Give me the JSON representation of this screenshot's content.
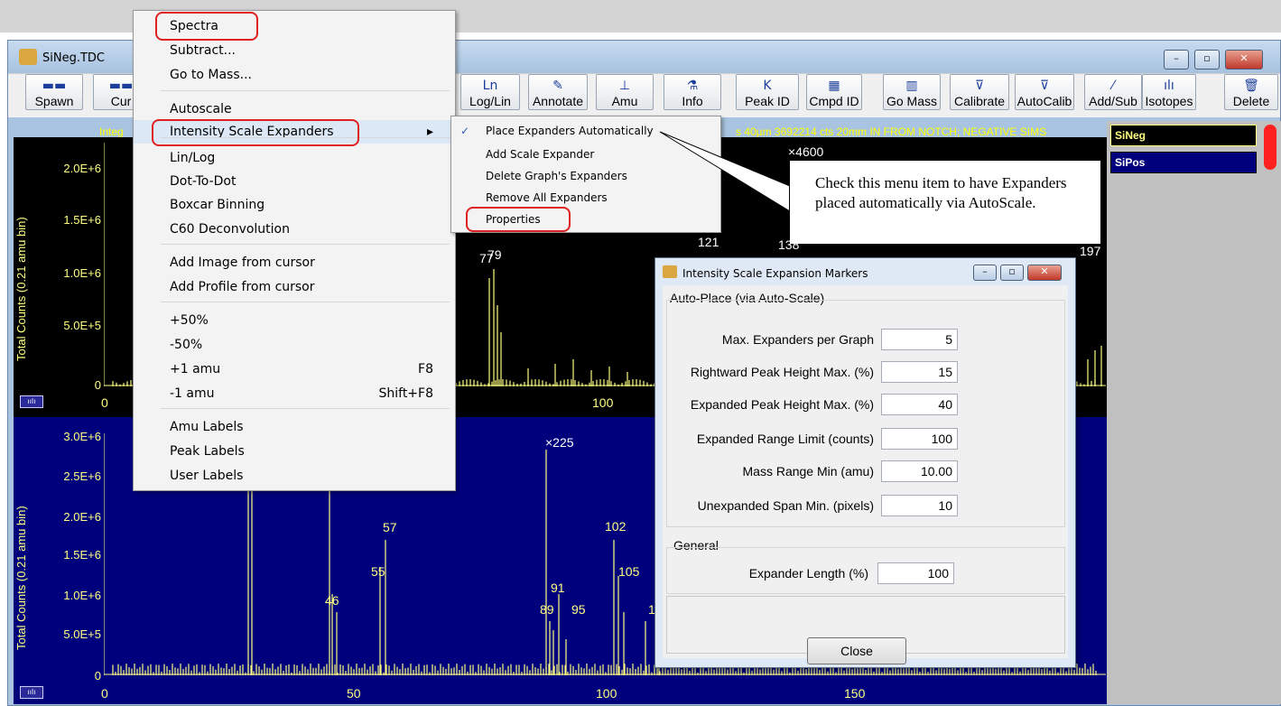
{
  "window": {
    "title": "SiNeg.TDC",
    "min_label": "–",
    "max_label": "▫",
    "close_label": "✕"
  },
  "toolbar": [
    {
      "label": "Spawn",
      "icon": "▬▬"
    },
    {
      "label": "Cur",
      "icon": "▬▬"
    },
    {
      "label": "Log/Lin",
      "icon": "Ln"
    },
    {
      "label": "Annotate",
      "icon": "✎"
    },
    {
      "label": "Amu",
      "icon": "⊥"
    },
    {
      "label": "Info",
      "icon": "⚗"
    },
    {
      "label": "Peak ID",
      "icon": "K"
    },
    {
      "label": "Cmpd ID",
      "icon": "▦"
    },
    {
      "label": "Go Mass",
      "icon": "▥"
    },
    {
      "label": "Calibrate",
      "icon": "⊽"
    },
    {
      "label": "AutoCalib",
      "icon": "⊽"
    },
    {
      "label": "Add/Sub",
      "icon": "⁄"
    },
    {
      "label": "Isotopes",
      "icon": "ılı"
    },
    {
      "label": "Delete",
      "icon": "🗑"
    }
  ],
  "plot_header": {
    "left": "Integ",
    "right": "s 40µm 3692214 cts 20mm IN FROM NOTCH; NEGATIVE SIMS"
  },
  "plot1": {
    "ylabel": "Total Counts (0.21 amu bin)",
    "yticks": [
      "2.0E+6",
      "1.5E+6",
      "1.0E+6",
      "5.0E+5",
      "0"
    ],
    "xticks": [
      "0",
      "100"
    ],
    "expander": "×4600",
    "peak_labels": [
      "77",
      "79",
      "121",
      "138",
      "197"
    ]
  },
  "plot2": {
    "ylabel": "Total Counts (0.21 amu bin)",
    "yticks": [
      "3.0E+6",
      "2.5E+6",
      "2.0E+6",
      "1.5E+6",
      "1.0E+6",
      "5.0E+5",
      "0"
    ],
    "xticks": [
      "0",
      "50",
      "100",
      "150"
    ],
    "expander": "×225",
    "peak_labels": [
      "46",
      "55",
      "57",
      "89",
      "91",
      "95",
      "102",
      "105",
      "1"
    ]
  },
  "spectra_list": [
    {
      "name": "SiNeg",
      "selected": true
    },
    {
      "name": "SiPos",
      "selected": false
    }
  ],
  "menu": {
    "items": [
      {
        "label": "Spectra",
        "shortcut": ""
      },
      {
        "label": "Subtract...",
        "shortcut": ""
      },
      {
        "label": "Go to Mass...",
        "shortcut": ""
      },
      {
        "label": "Autoscale",
        "shortcut": ""
      },
      {
        "label": "Intensity Scale Expanders",
        "shortcut": "▸"
      },
      {
        "label": "Lin/Log",
        "shortcut": ""
      },
      {
        "label": "Dot-To-Dot",
        "shortcut": ""
      },
      {
        "label": "Boxcar Binning",
        "shortcut": ""
      },
      {
        "label": "C60 Deconvolution",
        "shortcut": ""
      },
      {
        "label": "Add Image from cursor",
        "shortcut": ""
      },
      {
        "label": "Add Profile from cursor",
        "shortcut": ""
      },
      {
        "label": "+50%",
        "shortcut": ""
      },
      {
        "label": "-50%",
        "shortcut": ""
      },
      {
        "label": "+1 amu",
        "shortcut": "F8"
      },
      {
        "label": "-1 amu",
        "shortcut": "Shift+F8"
      },
      {
        "label": "Amu Labels",
        "shortcut": ""
      },
      {
        "label": "Peak Labels",
        "shortcut": ""
      },
      {
        "label": "User Labels",
        "shortcut": ""
      }
    ]
  },
  "submenu": {
    "items": [
      {
        "label": "Place Expanders Automatically",
        "checked": "✓"
      },
      {
        "label": "Add Scale Expander",
        "checked": ""
      },
      {
        "label": "Delete Graph's Expanders",
        "checked": ""
      },
      {
        "label": "Remove All Expanders",
        "checked": ""
      },
      {
        "label": "Properties",
        "checked": ""
      }
    ]
  },
  "callout": {
    "text": "Check this menu item to have Expanders placed automatically via AutoScale."
  },
  "dialog": {
    "title": "Intensity Scale Expansion Markers",
    "group_auto": "Auto-Place (via Auto-Scale)",
    "group_general": "General",
    "fields": [
      {
        "label": "Max. Expanders per Graph",
        "value": "5"
      },
      {
        "label": "Rightward Peak Height Max. (%)",
        "value": "15"
      },
      {
        "label": "Expanded Peak Height Max. (%)",
        "value": "40"
      },
      {
        "label": "Expanded Range Limit (counts)",
        "value": "100"
      },
      {
        "label": "Mass Range Min (amu)",
        "value": "10.00"
      },
      {
        "label": "Unexpanded Span Min. (pixels)",
        "value": "10"
      }
    ],
    "general_field": {
      "label": "Expander Length (%)",
      "value": "100"
    },
    "close_label": "Close"
  },
  "colors": {
    "plot1_bg": "#000000",
    "plot2_bg": "#00007c",
    "trace": "#ffff80",
    "highlight": "#e02020"
  }
}
